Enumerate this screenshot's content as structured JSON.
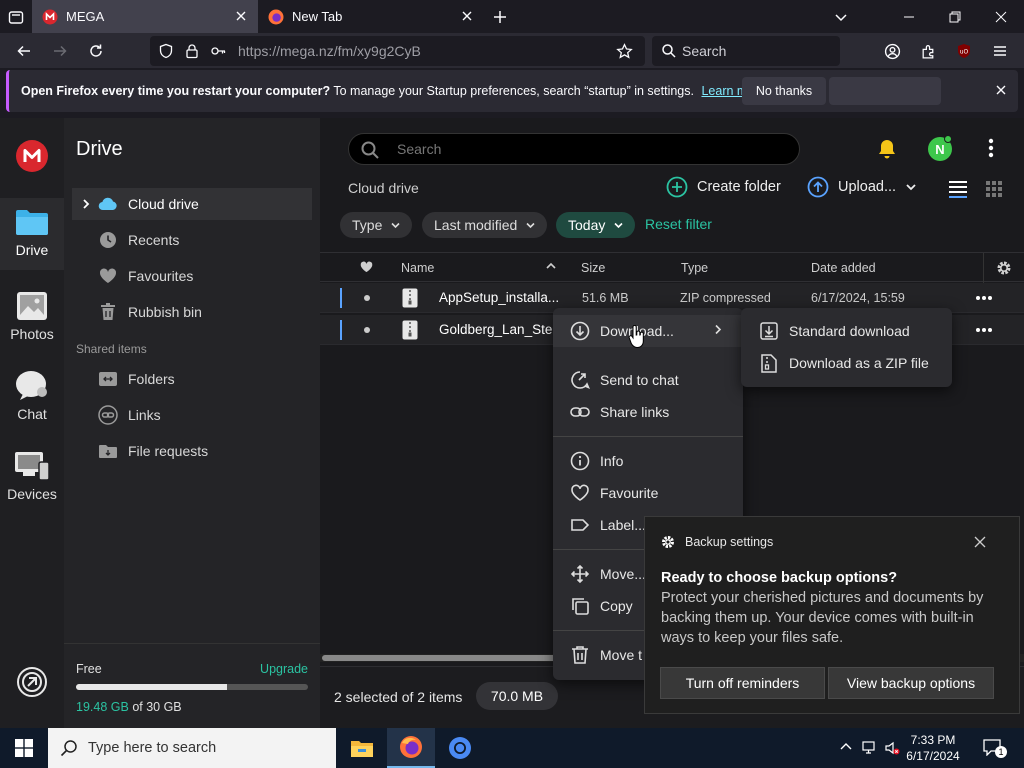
{
  "browser": {
    "tabs": [
      {
        "label": "MEGA",
        "active": true
      },
      {
        "label": "New Tab",
        "active": false
      }
    ],
    "url": "https://mega.nz/fm/xy9g2CyB",
    "search_placeholder": "Search"
  },
  "notification": {
    "bold": "Open Firefox every time you restart your computer?",
    "text": "To manage your Startup preferences, search “startup” in settings.",
    "link": "Learn more",
    "no_thanks": "No thanks"
  },
  "rail": {
    "drive": "Drive",
    "photos": "Photos",
    "chat": "Chat",
    "devices": "Devices"
  },
  "sidebar": {
    "title": "Drive",
    "items": [
      {
        "label": "Cloud drive"
      },
      {
        "label": "Recents"
      },
      {
        "label": "Favourites"
      },
      {
        "label": "Rubbish bin"
      }
    ],
    "shared_label": "Shared items",
    "shared": [
      {
        "label": "Folders"
      },
      {
        "label": "Links"
      },
      {
        "label": "File requests"
      }
    ],
    "storage": {
      "plan": "Free",
      "upgrade": "Upgrade",
      "used": "19.48 GB",
      "total_text": "of 30 GB",
      "fraction": 0.6493
    }
  },
  "main": {
    "search_placeholder": "Search",
    "avatar_initial": "N",
    "breadcrumb": "Cloud drive",
    "create_folder": "Create folder",
    "upload": "Upload...",
    "filters": {
      "type": "Type",
      "modified": "Last modified",
      "today": "Today",
      "reset": "Reset filter"
    },
    "columns": {
      "name": "Name",
      "size": "Size",
      "type": "Type",
      "date": "Date added"
    },
    "rows": [
      {
        "name": "AppSetup_installa...",
        "size": "51.6 MB",
        "type": "ZIP compressed",
        "date": "6/17/2024, 15:59"
      },
      {
        "name": "Goldberg_Lan_Ste",
        "size": "",
        "type": "",
        "date": ""
      }
    ],
    "selection": {
      "text": "2 selected of 2 items",
      "size": "70.0 MB"
    }
  },
  "context_menu": {
    "download": "Download...",
    "send_to_chat": "Send to chat",
    "share_links": "Share links",
    "info": "Info",
    "favourite": "Favourite",
    "label": "Label...",
    "move": "Move...",
    "copy": "Copy",
    "move_to_bin": "Move t"
  },
  "submenu": {
    "standard": "Standard download",
    "zip": "Download as a ZIP file"
  },
  "toast": {
    "header": "Backup settings",
    "title": "Ready to choose backup options?",
    "body": "Protect your cherished pictures and documents by backing them up. Your device comes with built-in ways to keep your files safe.",
    "btn_off": "Turn off reminders",
    "btn_view": "View backup options"
  },
  "taskbar": {
    "search_placeholder": "Type here to search",
    "time": "7:33 PM",
    "date": "6/17/2024",
    "notif_count": "1"
  },
  "colors": {
    "mega_red": "#d9272e",
    "accent_teal": "#2bc3a2",
    "firefox_link": "#80ebff"
  }
}
